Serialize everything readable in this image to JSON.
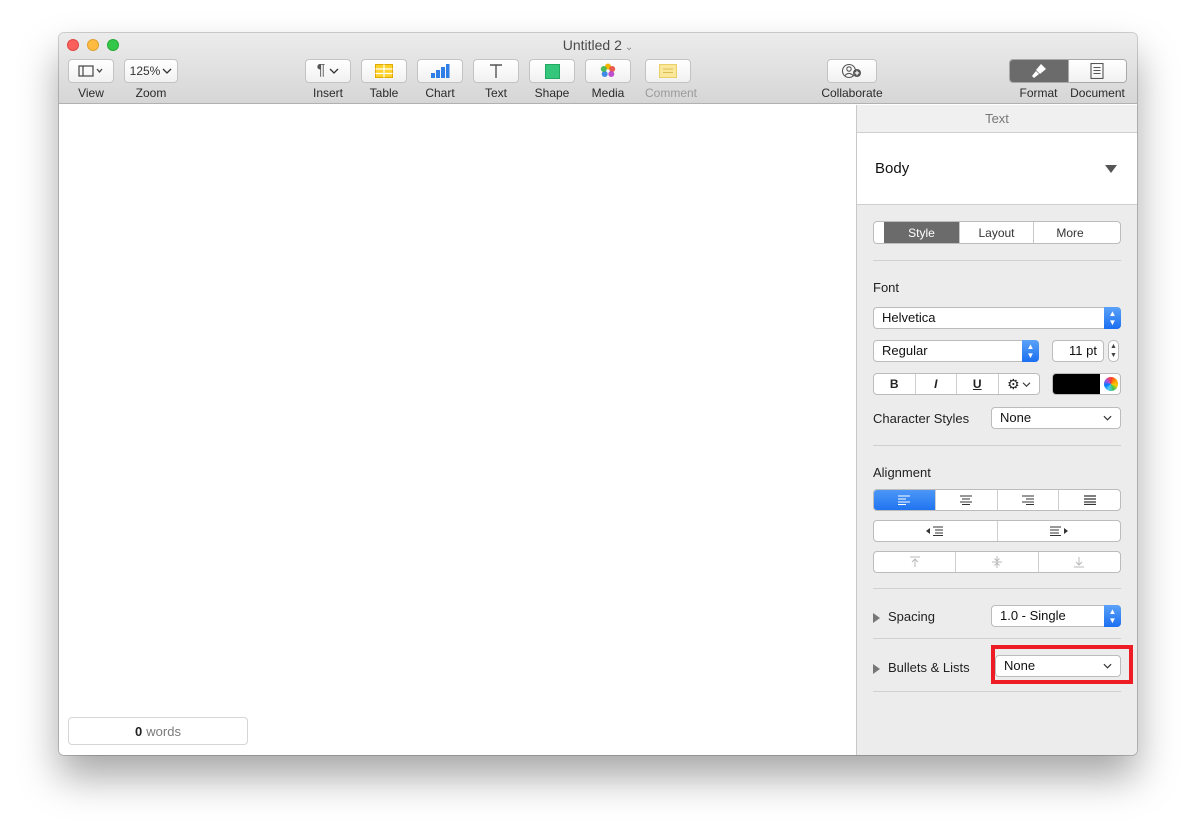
{
  "window": {
    "title": "Untitled 2"
  },
  "toolbar": {
    "view_label": "View",
    "zoom_value": "125%",
    "zoom_label": "Zoom",
    "insert_label": "Insert",
    "table_label": "Table",
    "chart_label": "Chart",
    "text_label": "Text",
    "shape_label": "Shape",
    "media_label": "Media",
    "comment_label": "Comment",
    "collaborate_label": "Collaborate",
    "format_label": "Format",
    "document_label": "Document"
  },
  "canvas": {
    "word_count": "0",
    "word_unit": "words"
  },
  "inspector": {
    "header": "Text",
    "paragraph_style": "Body",
    "tabs": [
      "Style",
      "Layout",
      "More"
    ],
    "font_section": "Font",
    "font_family": "Helvetica",
    "font_typeface": "Regular",
    "font_size": "11 pt",
    "bold": "B",
    "italic": "I",
    "underline": "U",
    "character_styles_label": "Character Styles",
    "character_styles_value": "None",
    "alignment_section": "Alignment",
    "spacing_label": "Spacing",
    "spacing_value": "1.0 - Single",
    "bullets_label": "Bullets & Lists",
    "bullets_value": "None"
  },
  "colors": {
    "accent": "#1f74f0",
    "highlight": "#ee1c24",
    "text_color_swatch": "#000000"
  },
  "icons": {
    "view": "sidebar-view-icon",
    "insert": "pilcrow-icon",
    "table": "table-icon",
    "chart": "bar-chart-icon",
    "text": "text-t-icon",
    "shape": "square-shape-icon",
    "media": "photos-flower-icon",
    "comment": "comment-note-icon",
    "collaborate": "person-add-icon",
    "format": "paintbrush-icon",
    "document": "document-icon"
  }
}
